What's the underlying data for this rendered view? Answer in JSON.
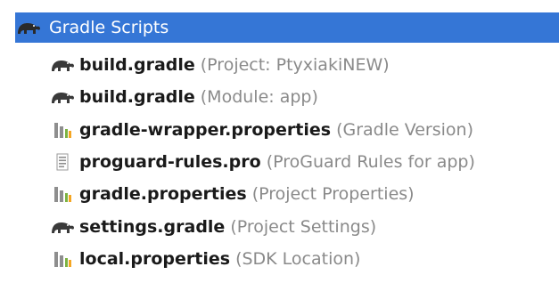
{
  "colors": {
    "selection": "#3576d6",
    "hint": "#8a8a8a",
    "text": "#1a1a1a",
    "gradle_icon": "#3a3a3a",
    "properties_bar_gray": "#8e8e8e",
    "properties_bar_green": "#7cb342",
    "properties_bar_orange": "#f5a623"
  },
  "group": {
    "label": "Gradle Scripts",
    "icon": "gradle-elephant-icon",
    "selected": true
  },
  "items": [
    {
      "name": "build.gradle",
      "hint": "(Project: PtyxiakiNEW)",
      "icon": "gradle-elephant-icon"
    },
    {
      "name": "build.gradle",
      "hint": "(Module: app)",
      "icon": "gradle-elephant-icon"
    },
    {
      "name": "gradle-wrapper.properties",
      "hint": "(Gradle Version)",
      "icon": "properties-file-icon"
    },
    {
      "name": "proguard-rules.pro",
      "hint": "(ProGuard Rules for app)",
      "icon": "text-file-icon"
    },
    {
      "name": "gradle.properties",
      "hint": "(Project Properties)",
      "icon": "properties-file-icon"
    },
    {
      "name": "settings.gradle",
      "hint": "(Project Settings)",
      "icon": "gradle-elephant-icon"
    },
    {
      "name": "local.properties",
      "hint": "(SDK Location)",
      "icon": "properties-file-icon"
    }
  ]
}
